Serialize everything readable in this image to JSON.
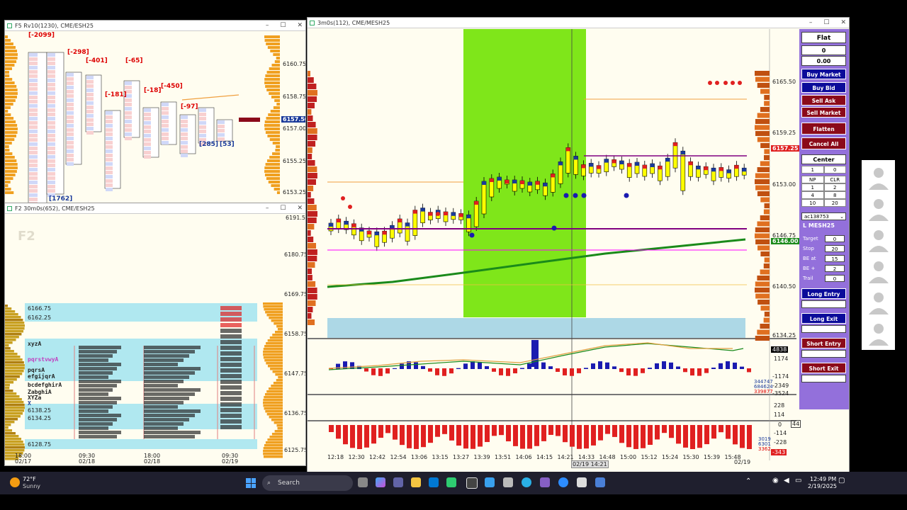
{
  "windows": {
    "top_left_title": "F5 Rv10(1230), CME/ESH25",
    "bottom_left_title": "F2 30m0s(652), CME/ESH25",
    "main_title": "3m0s(112), CME/MESH25",
    "bottom_left_label": "F2"
  },
  "top_left": {
    "prices": [
      "6160.75",
      "6158.75",
      "6157.00",
      "6155.25",
      "6153.25"
    ],
    "current_price": "6157.50",
    "delta_labels": [
      "[-2099]",
      "[-298]",
      "[-401]",
      "[-65]",
      "[-181]",
      "[-18]",
      "[-450]",
      "[-97]",
      "[285]",
      "[53]",
      "[1762]"
    ]
  },
  "bottom_left": {
    "prices": [
      "6191.50",
      "6180.75",
      "6169.75",
      "6158.75",
      "6147.75",
      "6136.75",
      "6125.75"
    ],
    "left_prices": [
      "6166.75",
      "6162.25",
      "6138.25",
      "6134.25",
      "6128.75"
    ],
    "times": [
      {
        "t": "18:00",
        "d": "02/17"
      },
      {
        "t": "09:30",
        "d": "02/18"
      },
      {
        "t": "18:00",
        "d": "02/18"
      },
      {
        "t": "09:30",
        "d": "02/19"
      }
    ],
    "tpo_rows": [
      "xyzA",
      "pqrstvwyA",
      "pqrsA",
      "efgijqrA",
      "bcdefghirA",
      "ZabghiA",
      "XYZa",
      "X"
    ]
  },
  "main": {
    "prices": [
      "6165.50",
      "6159.25",
      "6153.00",
      "6146.75",
      "6140.50"
    ],
    "current_price": "6157.25",
    "green_price": "6146.00",
    "band_price": "6134.25",
    "times": [
      "12:18",
      "12:30",
      "12:42",
      "12:54",
      "13:06",
      "13:15",
      "13:27",
      "13:39",
      "13:51",
      "14:06",
      "14:15",
      "14:21",
      "14:33",
      "14:48",
      "15:00",
      "15:12",
      "15:24",
      "15:30",
      "15:39",
      "15:48"
    ],
    "cursor_time": "02/19 14:21",
    "last_date": "02/19",
    "ind1_labels": [
      "4838",
      "1174",
      "-1174",
      "-2349",
      "-3524"
    ],
    "ind1_values": [
      "344747",
      "684624",
      "339877"
    ],
    "ind2_labels": [
      "228",
      "114",
      "0",
      "-114",
      "-228"
    ],
    "ind2_values": [
      "3019",
      "6301",
      "3362"
    ],
    "ind2_last": "-343",
    "ind2_side": "44"
  },
  "order_panel": {
    "position": "Flat",
    "qty": "0",
    "pnl": "0.00",
    "buttons": {
      "buy_market": "Buy Market",
      "buy_bid": "Buy Bid",
      "sell_ask": "Sell Ask",
      "sell_market": "Sell Market",
      "flatten": "Flatten",
      "cancel_all": "Cancel All",
      "center": "Center"
    },
    "qty_row": [
      "1",
      "0"
    ],
    "grid": [
      "NP",
      "CLR",
      "1",
      "2",
      "4",
      "8",
      "10",
      "20"
    ],
    "account": "ac138753",
    "instrument": "L MESH25",
    "target_label": "Target",
    "target_value": "0",
    "stop_label": "Stop",
    "stop_value": "20",
    "be_at_label": "BE at",
    "be_at_value": "15",
    "be_plus_label": "BE +",
    "be_plus_value": "2",
    "trail_label": "Trail",
    "trail_value": "0",
    "long_entry": "Long Entry",
    "long_exit": "Long Exit",
    "short_entry": "Short Entry",
    "short_exit": "Short Exit"
  },
  "taskbar": {
    "weather_temp": "72°F",
    "weather_desc": "Sunny",
    "search_placeholder": "Search",
    "time": "12:49 PM",
    "date": "2/19/2025"
  }
}
